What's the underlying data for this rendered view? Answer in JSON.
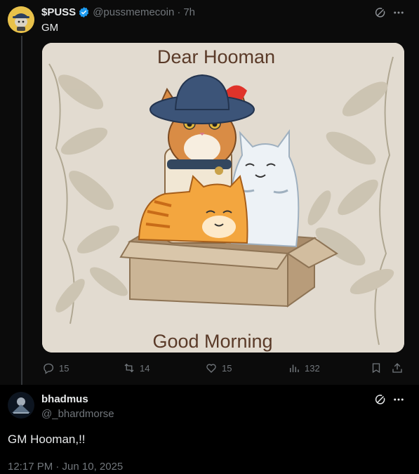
{
  "post": {
    "author_name": "$PUSS",
    "handle": "@pussmemecoin",
    "separator": "·",
    "time": "7h",
    "text": "GM",
    "image": {
      "top_caption": "Dear Hooman",
      "bottom_caption": "Good Morning"
    },
    "actions": {
      "replies": "15",
      "reposts": "14",
      "likes": "15",
      "views": "132"
    }
  },
  "reply": {
    "author_name": "bhadmus",
    "handle": "@_bhardmorse",
    "text": "GM Hooman,!!",
    "timestamp": "12:17 PM · Jun 10, 2025"
  },
  "icons": {
    "verified": "verified-badge-icon",
    "grok": "grok-icon",
    "more": "more-icon",
    "reply": "reply-icon",
    "repost": "repost-icon",
    "like": "like-icon",
    "views": "views-icon",
    "bookmark": "bookmark-icon",
    "share": "share-icon"
  },
  "colors": {
    "verified": "#1d9bf0",
    "text_primary": "#e7e9ea",
    "text_secondary": "#71767b",
    "image_bg": "#e2dbd0",
    "caption": "#5a3a28"
  }
}
